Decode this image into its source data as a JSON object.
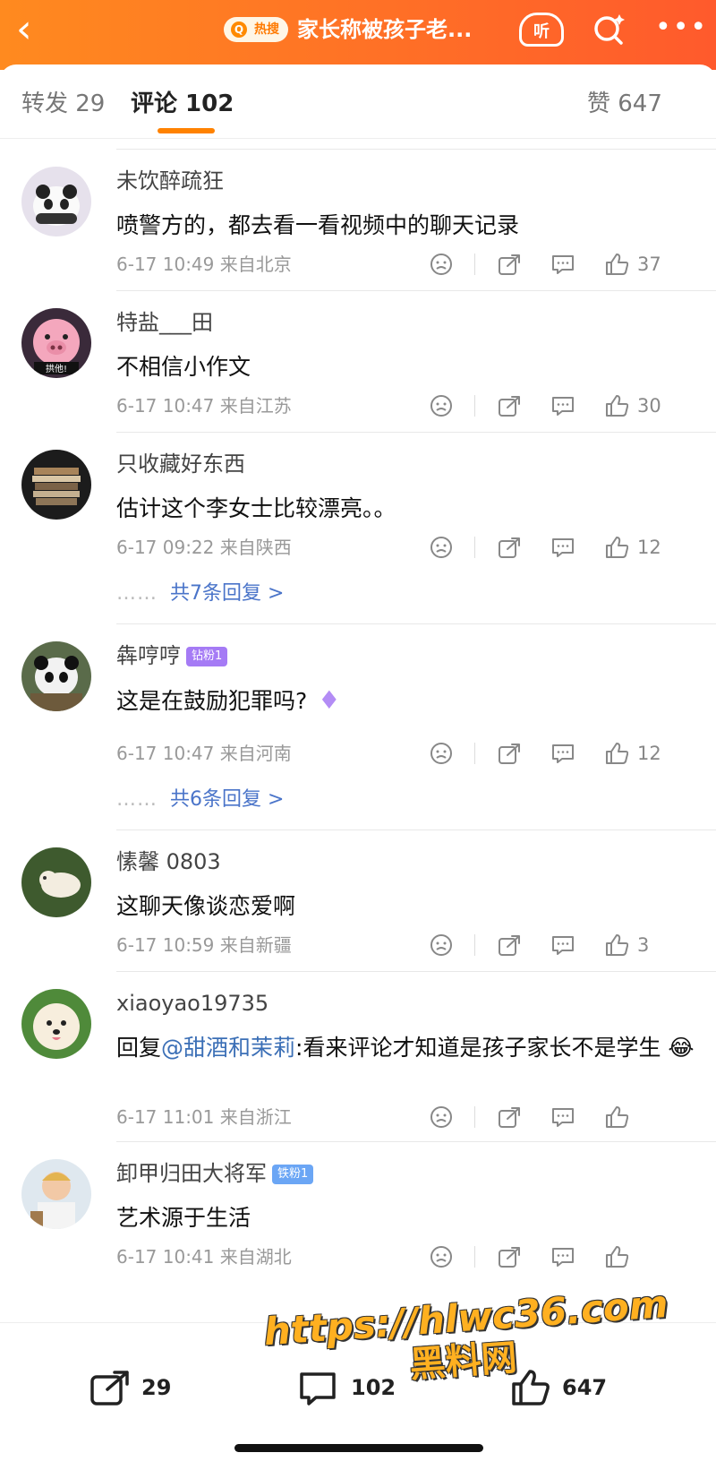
{
  "header": {
    "back_icon": "chevron-left-icon",
    "hot_badge": "热搜",
    "title": "家长称被孩子老...",
    "listen_label": "听",
    "search_icon": "search-icon",
    "more_icon": "more-icon"
  },
  "tabs": {
    "repost": "转发 29",
    "comments": "评论 102",
    "likes": "赞 647"
  },
  "comments": [
    {
      "name": "未饮醉疏狂",
      "text": "喷警方的，都去看一看视频中的聊天记录",
      "meta": "6-17 10:49  来自北京",
      "likes": "37"
    },
    {
      "name": "特盐___田",
      "text": "不相信小作文",
      "meta": "6-17 10:47  来自江苏",
      "likes": "30",
      "avatar_caption": "拱他!"
    },
    {
      "name": "只收藏好东西",
      "text": "估计这个李女士比较漂亮。。",
      "meta": "6-17 09:22  来自陕西",
      "likes": "12",
      "replies": "共7条回复 >"
    },
    {
      "name": "犇哼哼",
      "badge": "钻粉1",
      "text": "这是在鼓励犯罪吗?",
      "meta": "6-17 10:47  来自河南",
      "likes": "12",
      "replies": "共6条回复 >"
    },
    {
      "name": "愫馨 0803",
      "text": "这聊天像谈恋爱啊",
      "meta": "6-17 10:59  来自新疆",
      "likes": "3"
    },
    {
      "name": "xiaoyao19735",
      "reply_prefix": "回复",
      "mention": "@甜酒和茉莉",
      "text": ":看来评论才知道是孩子家长不是学生 😂",
      "meta": "6-17 11:01  来自浙江",
      "likes": ""
    },
    {
      "name": "卸甲归田大将军",
      "badge": "铁粉1",
      "text": "艺术源于生活",
      "meta": "6-17 10:41  来自湖北",
      "likes": ""
    }
  ],
  "bottom": {
    "repost_count": "29",
    "comment_count": "102",
    "like_count": "647"
  },
  "watermark": {
    "line1": "https://hlwc36.com",
    "line2": "黑料网"
  },
  "colors": {
    "header_start": "#ff8a1f",
    "header_end": "#ff5a2c",
    "tab_indicator": "#ff8200",
    "link": "#4a74c9"
  }
}
